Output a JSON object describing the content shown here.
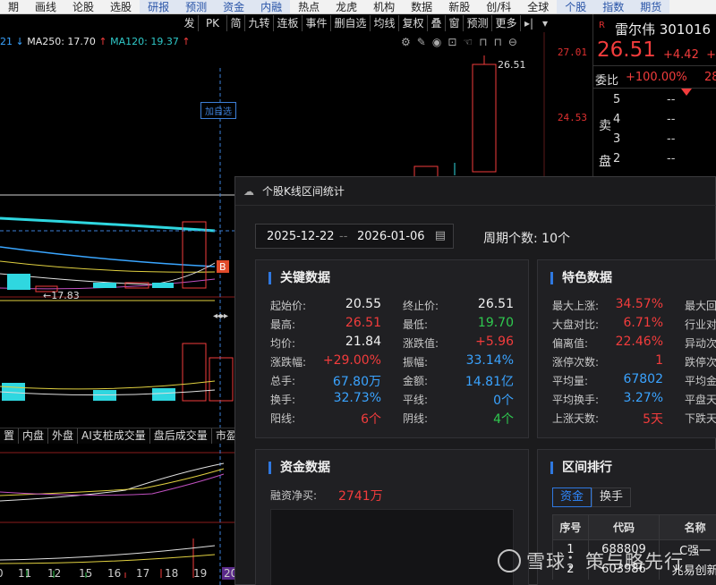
{
  "top_menu": [
    "期",
    "画线",
    "论股",
    "选股",
    "研报",
    "预测",
    "资金",
    "内融",
    "热点",
    "龙虎",
    "机构",
    "数据",
    "新股",
    "创/科",
    "全球",
    "个股",
    "指数",
    "期货"
  ],
  "top_menu_selected": [
    "研报",
    "预测",
    "资金",
    "内融",
    "个股",
    "指数",
    "期货"
  ],
  "chart_toolbar": {
    "buttons": [
      "发",
      "PK",
      "简",
      "九转",
      "连板",
      "事件",
      "删自选",
      "均线",
      "复权",
      "叠",
      "窗",
      "预测",
      "更多"
    ],
    "icons": [
      "arrow-right-bar-icon",
      "collapse-icon"
    ]
  },
  "ma_legend": [
    {
      "text": "21",
      "color": "#3aa3ff"
    },
    {
      "text": "↓",
      "color": "#3aa3ff"
    },
    {
      "text": "MA250: 17.70",
      "color": "#e8e8e8"
    },
    {
      "text": "↑",
      "color": "#f23c3c"
    },
    {
      "text": "MA120: 19.37",
      "color": "#2fc9c9"
    },
    {
      "text": "↑",
      "color": "#f23c3c"
    }
  ],
  "chart_tools": [
    "gear-icon",
    "edit-pen-icon",
    "eye-icon",
    "bag-icon",
    "hand-icon",
    "lock-icon",
    "lock-alt-icon",
    "minus-circle-icon"
  ],
  "chart": {
    "add_watchlist_tag": "加自选",
    "price_ticks": [
      "27.01",
      "24.53"
    ],
    "high_label": "26.51",
    "low_label": "17.83",
    "b_marker": "B",
    "sub_tabs": [
      "置",
      "内盘",
      "外盘",
      "AI支桩成交量",
      "盘后成交量",
      "市盈"
    ],
    "x_ticks": [
      "0",
      "11",
      "12",
      "15",
      "16",
      "17",
      "18",
      "19",
      "20"
    ]
  },
  "quote": {
    "tag": "R",
    "name": "雷尔伟 301016",
    "price": "26.51",
    "change": "+4.42",
    "extra": "+",
    "weibi_label": "委比",
    "weibi_value": "+100.00%",
    "weibi_value2": "28",
    "asks": [
      {
        "level": "5",
        "value": "--"
      },
      {
        "level": "4",
        "value": "--"
      },
      {
        "level": "3",
        "value": "--"
      },
      {
        "level": "2",
        "value": "--"
      }
    ],
    "side_labels": [
      "卖",
      "盘"
    ]
  },
  "dialog": {
    "title": "个股K线区间统计",
    "start_date": "2025-12-22",
    "separator": "--",
    "end_date": "2026-01-06",
    "cycle_label": "周期个数:",
    "cycle_value": "10个",
    "key_data": {
      "title": "关键数据",
      "rows": [
        [
          {
            "k": "起始价:",
            "v": "20.55",
            "c": "white"
          },
          {
            "k": "终止价:",
            "v": "26.51",
            "c": "white"
          }
        ],
        [
          {
            "k": "最高:",
            "v": "26.51",
            "c": "red"
          },
          {
            "k": "最低:",
            "v": "19.70",
            "c": "green"
          }
        ],
        [
          {
            "k": "均价:",
            "v": "21.84",
            "c": "white"
          },
          {
            "k": "涨跌值:",
            "v": "+5.96",
            "c": "red"
          }
        ],
        [
          {
            "k": "涨跌幅:",
            "v": "+29.00%",
            "c": "red"
          },
          {
            "k": "振幅:",
            "v": "33.14%",
            "c": "blue"
          }
        ],
        [
          {
            "k": "总手:",
            "v": "67.80万",
            "c": "blue"
          },
          {
            "k": "金额:",
            "v": "14.81亿",
            "c": "blue"
          }
        ],
        [
          {
            "k": "换手:",
            "v": "32.73%",
            "c": "blue"
          },
          {
            "k": "平线:",
            "v": "0个",
            "c": "blue"
          }
        ],
        [
          {
            "k": "阳线:",
            "v": "6个",
            "c": "red"
          },
          {
            "k": "阴线:",
            "v": "4个",
            "c": "green"
          }
        ]
      ]
    },
    "special_data": {
      "title": "特色数据",
      "rows": [
        [
          {
            "k": "最大上涨:",
            "v": "34.57%",
            "c": "red"
          },
          {
            "k": "最大回"
          }
        ],
        [
          {
            "k": "大盘对比:",
            "v": "6.71%",
            "c": "red"
          },
          {
            "k": "行业对"
          }
        ],
        [
          {
            "k": "偏离值:",
            "v": "22.46%",
            "c": "red"
          },
          {
            "k": "异动次"
          }
        ],
        [
          {
            "k": "涨停次数:",
            "v": "1",
            "c": "red"
          },
          {
            "k": "跌停次"
          }
        ],
        [
          {
            "k": "平均量:",
            "v": "67802",
            "c": "blue"
          },
          {
            "k": "平均金"
          }
        ],
        [
          {
            "k": "平均换手:",
            "v": "3.27%",
            "c": "blue"
          },
          {
            "k": "平盘天"
          }
        ],
        [
          {
            "k": "上涨天数:",
            "v": "5天",
            "c": "red"
          },
          {
            "k": "下跌天"
          }
        ]
      ]
    },
    "fund_data": {
      "title": "资金数据",
      "margin_label": "融资净买:",
      "margin_value": "2741万"
    },
    "ranking": {
      "title": "区间排行",
      "tabs": [
        "资金",
        "换手"
      ],
      "columns": [
        "序号",
        "代码",
        "名称"
      ],
      "rows": [
        [
          "1",
          "688809",
          "C强一"
        ],
        [
          "2",
          "603986",
          "兆易创新"
        ]
      ]
    }
  },
  "watermark": "雪球：策与略先行"
}
